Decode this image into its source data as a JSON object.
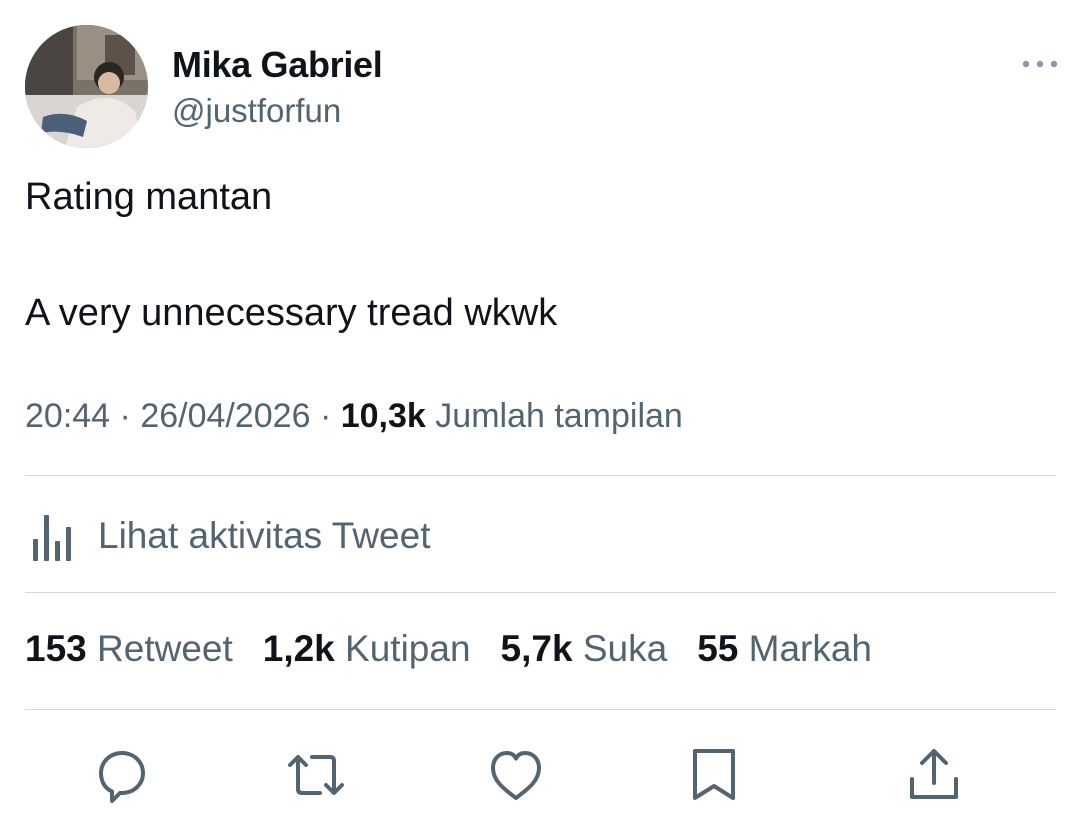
{
  "author": {
    "name": "Mika Gabriel",
    "handle": "@justforfun"
  },
  "tweet": {
    "line1": "Rating mantan",
    "line2": "A very unnecessary tread wkwk"
  },
  "meta": {
    "time": "20:44",
    "separator": "·",
    "date": "26/04/2026",
    "views_count": "10,3k",
    "views_label": "Jumlah tampilan"
  },
  "activity": {
    "label": "Lihat aktivitas Tweet",
    "icon": "bar-chart-icon"
  },
  "stats": [
    {
      "count": "153",
      "label": "Retweet"
    },
    {
      "count": "1,2k",
      "label": "Kutipan"
    },
    {
      "count": "5,7k",
      "label": "Suka"
    },
    {
      "count": "55",
      "label": "Markah"
    }
  ],
  "actions": [
    "reply-icon",
    "retweet-icon",
    "like-icon",
    "bookmark-icon",
    "share-icon"
  ],
  "colors": {
    "text_primary": "#0f1419",
    "text_secondary": "#536471",
    "divider": "#cfd9de",
    "icon": "#536471"
  }
}
